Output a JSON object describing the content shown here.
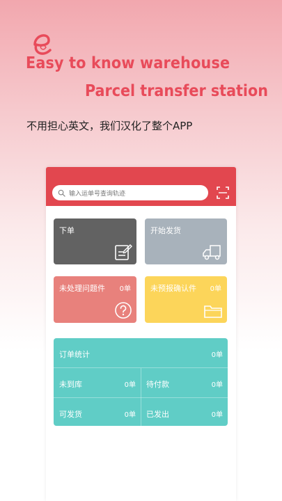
{
  "promo": {
    "logo_letter": "e",
    "line1": "Easy to know warehouse",
    "line2": "Parcel transfer station",
    "line3": "不用担心英文，我们汉化了整个APP"
  },
  "app": {
    "search_placeholder": "输入运单号查询轨迹",
    "tiles": {
      "order": {
        "label": "下单",
        "icon": "edit-form-icon",
        "color": "#626262"
      },
      "ship": {
        "label": "开始发货",
        "icon": "truck-icon",
        "color": "#a8b2bb"
      },
      "unprocessed": {
        "label": "未处理问题件",
        "count": "0单",
        "icon": "question-icon",
        "color": "#e8817c"
      },
      "unforecast": {
        "label": "未预报确认件",
        "count": "0单",
        "icon": "folder-icon",
        "color": "#fcd55a"
      }
    },
    "stats": {
      "color": "#60cdc6",
      "title": "订单统计",
      "title_count": "0单",
      "not_arrived": "未到库",
      "not_arrived_count": "0单",
      "pending_payment": "待付款",
      "pending_payment_count": "0单",
      "shippable": "可发货",
      "shippable_count": "0单",
      "shipped": "已发出",
      "shipped_count": "0单"
    },
    "header_color": "#e2474f",
    "accent_text_color": "#e84b5a"
  }
}
